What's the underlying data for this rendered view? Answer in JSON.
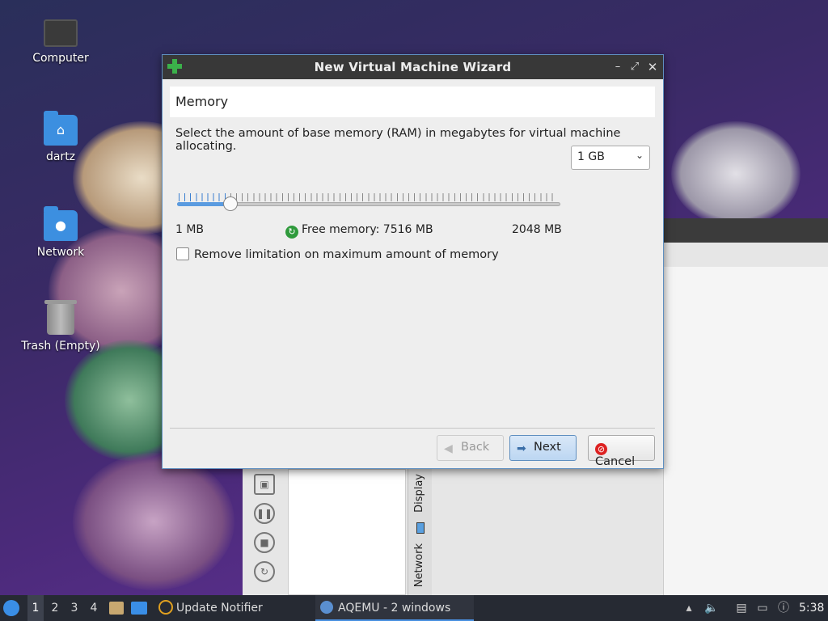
{
  "desktop": {
    "icons": [
      {
        "label": "Computer"
      },
      {
        "label": "dartz"
      },
      {
        "label": "Network"
      },
      {
        "label": "Trash (Empty)"
      }
    ]
  },
  "background_window": {
    "tabs": [
      "Display",
      "Network"
    ]
  },
  "dialog": {
    "title": "New Virtual Machine Wizard",
    "section_title": "Memory",
    "description": "Select the amount of base memory (RAM) in megabytes for virtual machine allocating.",
    "memory_select": {
      "value": "1 GB"
    },
    "slider": {
      "min_label": "1 MB",
      "max_label": "2048 MB",
      "value_mb": 1024,
      "max_mb": 2048,
      "position_fraction": 0.14
    },
    "free_memory_text": "Free memory: 7516 MB",
    "checkbox_label": "Remove limitation on maximum amount of memory",
    "checkbox_checked": false,
    "buttons": {
      "back": "Back",
      "next": "Next",
      "cancel": "Cancel"
    }
  },
  "taskbar": {
    "workspaces": [
      "1",
      "2",
      "3",
      "4"
    ],
    "active_workspace": "1",
    "tasks": [
      {
        "label": "Update Notifier"
      },
      {
        "label": "AQEMU - 2 windows"
      }
    ],
    "clock": "5:38"
  },
  "colors": {
    "accent": "#5a9be0",
    "titlebar": "#383838",
    "taskbar": "#262a33"
  }
}
